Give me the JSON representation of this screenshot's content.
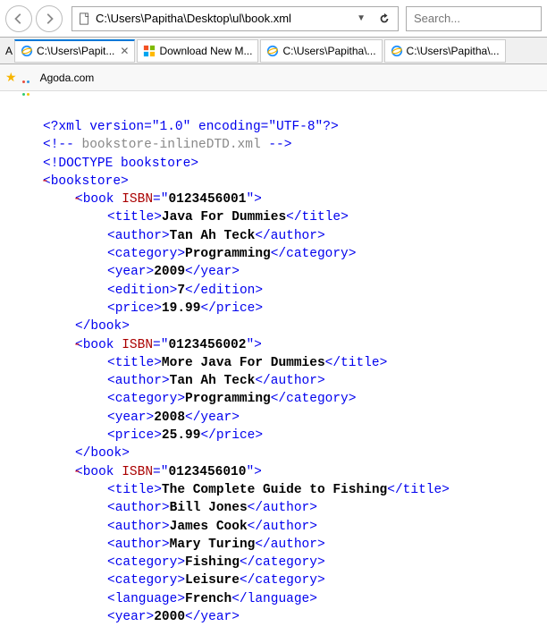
{
  "toolbar": {
    "url": "C:\\Users\\Papitha\\Desktop\\ul\\book.xml",
    "search_placeholder": "Search..."
  },
  "tabs": {
    "prefix": "A",
    "items": [
      {
        "label": "C:\\Users\\Papit...",
        "active": true,
        "icon": "ie"
      },
      {
        "label": "Download New M...",
        "active": false,
        "icon": "ms"
      },
      {
        "label": "C:\\Users\\Papitha\\...",
        "active": false,
        "icon": "ie"
      },
      {
        "label": "C:\\Users\\Papitha\\...",
        "active": false,
        "icon": "ie"
      }
    ]
  },
  "favorites": {
    "items": [
      {
        "label": "Agoda.com"
      }
    ]
  },
  "xml": {
    "prolog": "<?xml version=\"1.0\" encoding=\"UTF-8\"?>",
    "comment": "<!-- bookstore-inlineDTD.xml -->",
    "doctype": "<!DOCTYPE bookstore>",
    "root": "bookstore",
    "books": [
      {
        "isbn": "0123456001",
        "children": [
          {
            "tag": "title",
            "text": "Java For Dummies"
          },
          {
            "tag": "author",
            "text": "Tan Ah Teck"
          },
          {
            "tag": "category",
            "text": "Programming"
          },
          {
            "tag": "year",
            "text": "2009"
          },
          {
            "tag": "edition",
            "text": "7"
          },
          {
            "tag": "price",
            "text": "19.99"
          }
        ],
        "closed": true
      },
      {
        "isbn": "0123456002",
        "children": [
          {
            "tag": "title",
            "text": "More Java For Dummies"
          },
          {
            "tag": "author",
            "text": "Tan Ah Teck"
          },
          {
            "tag": "category",
            "text": "Programming"
          },
          {
            "tag": "year",
            "text": "2008"
          },
          {
            "tag": "price",
            "text": "25.99"
          }
        ],
        "closed": true
      },
      {
        "isbn": "0123456010",
        "children": [
          {
            "tag": "title",
            "text": "The Complete Guide to Fishing"
          },
          {
            "tag": "author",
            "text": "Bill Jones"
          },
          {
            "tag": "author",
            "text": "James Cook"
          },
          {
            "tag": "author",
            "text": "Mary Turing"
          },
          {
            "tag": "category",
            "text": "Fishing"
          },
          {
            "tag": "category",
            "text": "Leisure"
          },
          {
            "tag": "language",
            "text": "French"
          },
          {
            "tag": "year",
            "text": "2000"
          }
        ],
        "closed": false
      }
    ]
  }
}
